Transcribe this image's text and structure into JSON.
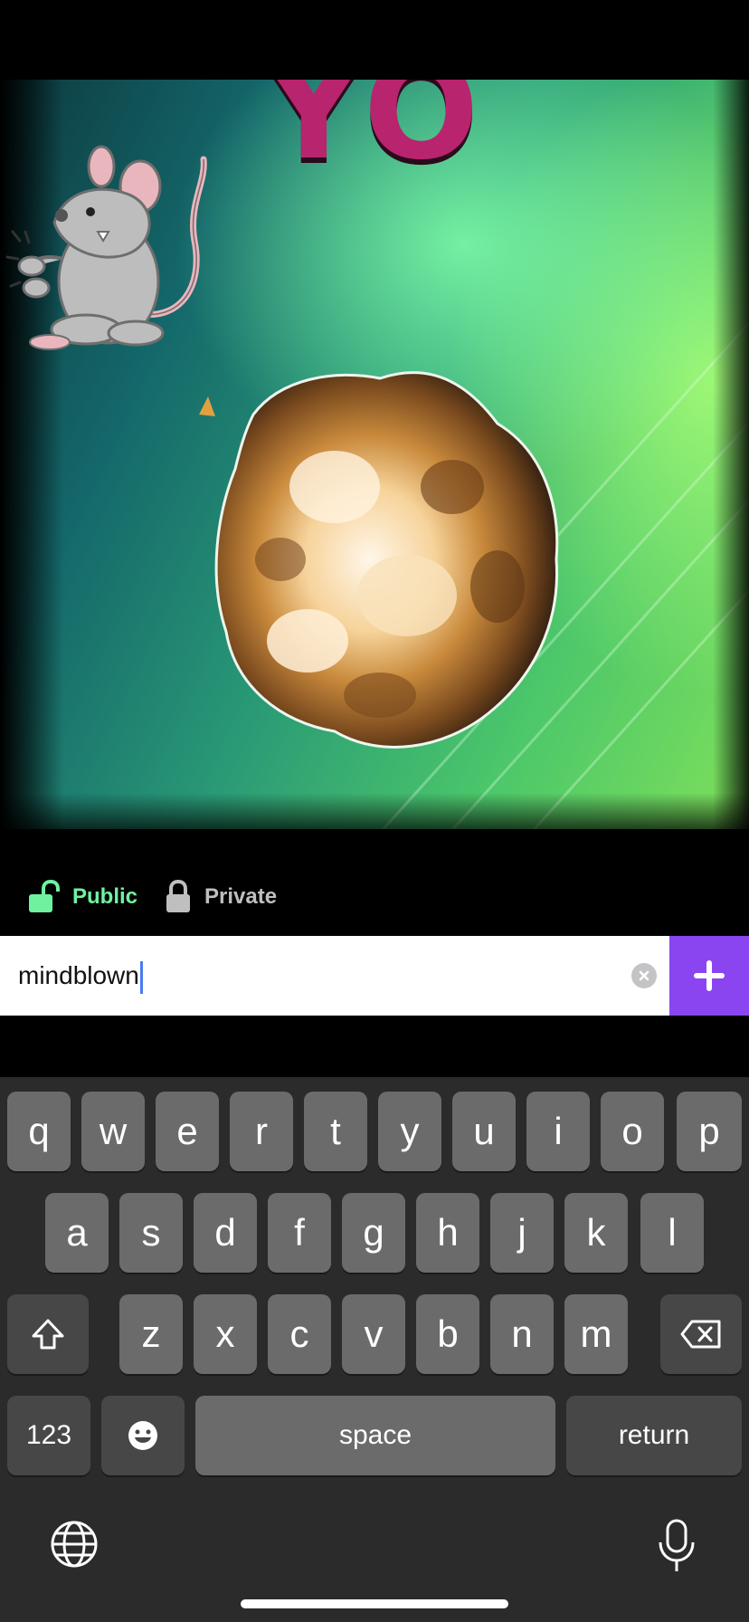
{
  "preview": {
    "caption_text": "YO",
    "sticker_icon": "cartoon-rat",
    "effect_icon": "explosion"
  },
  "privacy": {
    "public_label": "Public",
    "private_label": "Private",
    "selected": "public",
    "active_color": "#6ff2a0"
  },
  "tag_input": {
    "value": "mindblown",
    "clear_icon": "clear-icon",
    "add_icon": "plus-icon",
    "add_color": "#8b45f0"
  },
  "keyboard": {
    "row1": [
      "q",
      "w",
      "e",
      "r",
      "t",
      "y",
      "u",
      "i",
      "o",
      "p"
    ],
    "row2": [
      "a",
      "s",
      "d",
      "f",
      "g",
      "h",
      "j",
      "k",
      "l"
    ],
    "row3": [
      "z",
      "x",
      "c",
      "v",
      "b",
      "n",
      "m"
    ],
    "numbers_label": "123",
    "space_label": "space",
    "return_label": "return",
    "shift_icon": "shift-icon",
    "delete_icon": "backspace-icon",
    "emoji_icon": "emoji-icon",
    "globe_icon": "globe-icon",
    "mic_icon": "microphone-icon"
  }
}
